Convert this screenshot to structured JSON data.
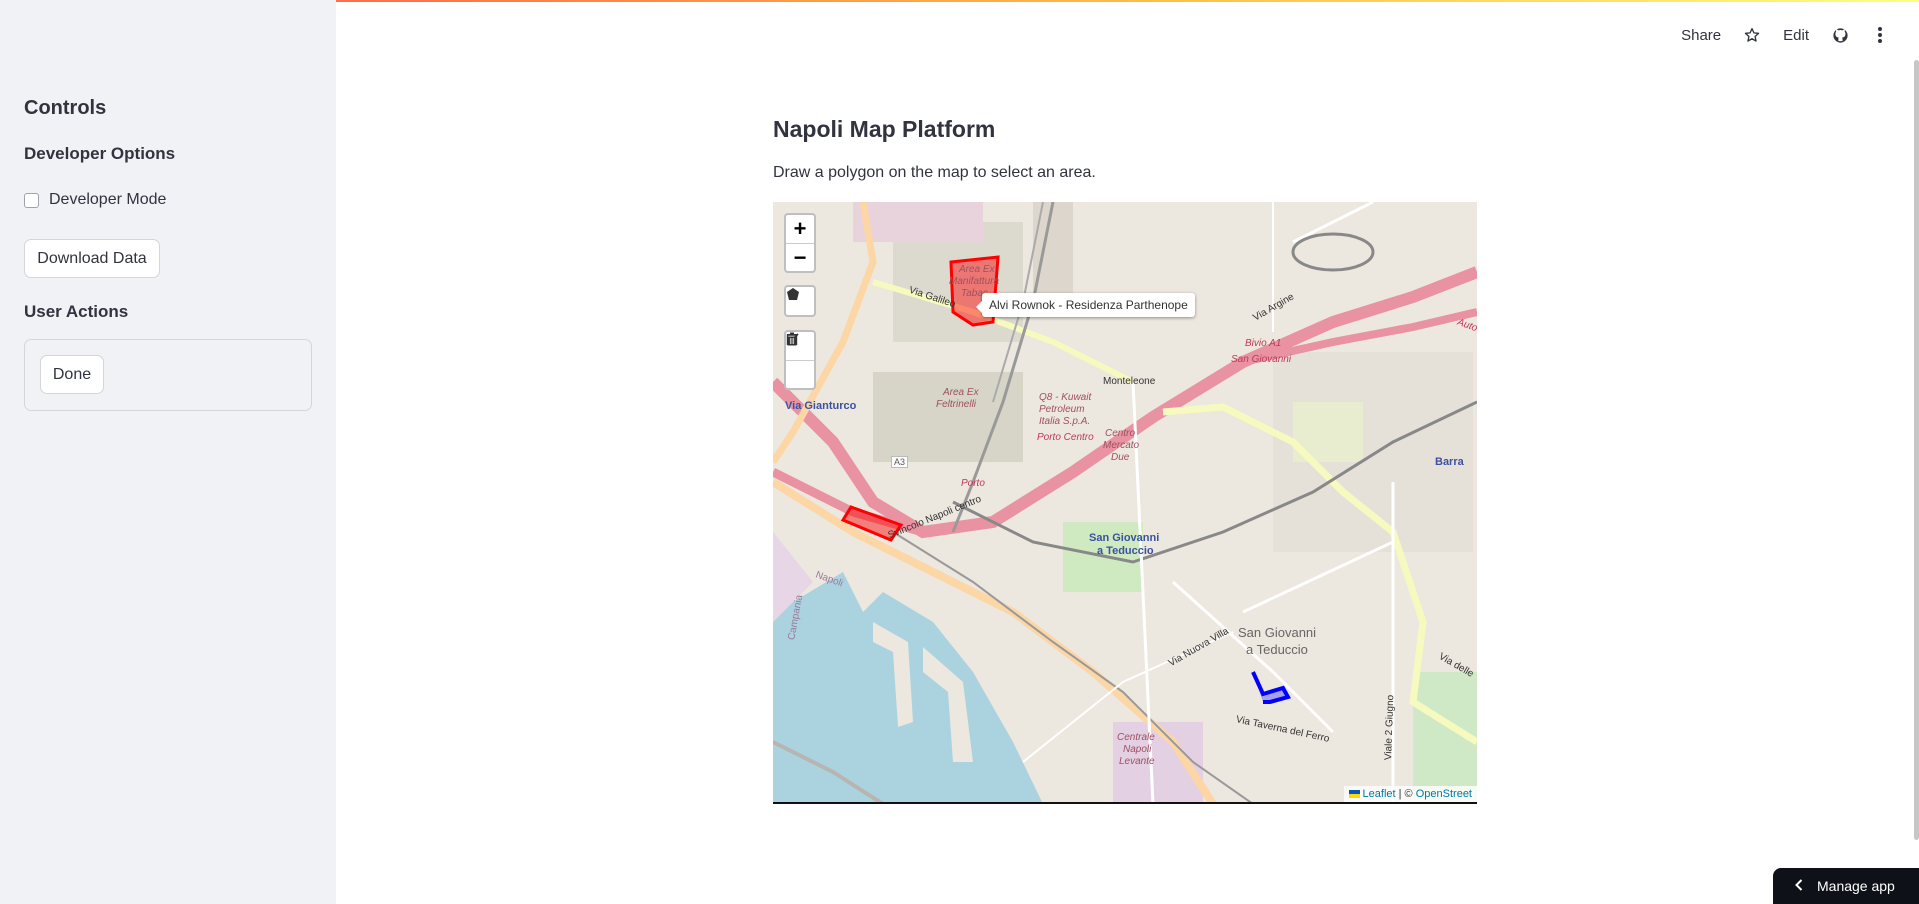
{
  "sidebar": {
    "title": "Controls",
    "developer_options_heading": "Developer Options",
    "developer_mode_label": "Developer Mode",
    "developer_mode_checked": false,
    "download_button": "Download Data",
    "user_actions_heading": "User Actions",
    "done_button": "Done"
  },
  "header": {
    "share": "Share",
    "star_icon": "star-icon",
    "edit": "Edit",
    "github_icon": "github-icon",
    "menu_icon": "kebab-menu-icon"
  },
  "main": {
    "title": "Napoli Map Platform",
    "description": "Draw a polygon on the map to select an area."
  },
  "map": {
    "zoom_in": "+",
    "zoom_out": "−",
    "tools": [
      "polygon-tool-icon",
      "edit-layers-icon",
      "trash-icon"
    ],
    "tooltip": "Alvi Rownok - Residenza Parthenope",
    "attribution": {
      "leaflet": "Leaflet",
      "separator": "| ©",
      "osm": "OpenStreet"
    },
    "labels": {
      "via_gianturco": "Via Gianturco",
      "area_ex_feltrinelli_1": "Area Ex",
      "area_ex_feltrinelli_2": "Feltrinelli",
      "area_ex_manifattura_1": "Area Ex",
      "area_ex_manifattura_2": "Manifattura",
      "area_ex_manifattura_3": "Tabac",
      "monteleone": "Monteleone",
      "q8_1": "Q8 - Kuwait",
      "q8_2": "Petroleum",
      "q8_3": "Italia S.p.A.",
      "porto_centro": "Porto Centro",
      "centro_mercato_1": "Centro",
      "centro_mercato_2": "Mercato",
      "centro_mercato_3": "Due",
      "san_giovanni": "San Giovanni",
      "bivio_a1": "Bivio A1",
      "sgt_station_1": "San Giovanni",
      "sgt_station_2": "a Teduccio",
      "sgt_area_1": "San Giovanni",
      "sgt_area_2": "a Teduccio",
      "barra": "Barra",
      "porto": "Porto",
      "svincolo": "Svincolo Napoli centro",
      "napoli": "Napoli",
      "campania": "Campania",
      "centrale_1": "Centrale",
      "centrale_2": "Napoli",
      "centrale_3": "Levante",
      "a3": "A3",
      "via_galileo": "Via Galileo",
      "via_argine": "Via Argine",
      "via_nuova_villa": "Via Nuova Villa",
      "via_taverna": "Via Taverna del Ferro",
      "viale_2_giugno": "Viale 2 Giugno",
      "via_delle": "Via delle",
      "auto": "Auto"
    },
    "colors": {
      "selected_polygon": "#ff0000",
      "user_polygon": "#0000ff",
      "water": "#aad3df",
      "motorway": "#e892a2"
    }
  },
  "manage_app": "Manage app"
}
